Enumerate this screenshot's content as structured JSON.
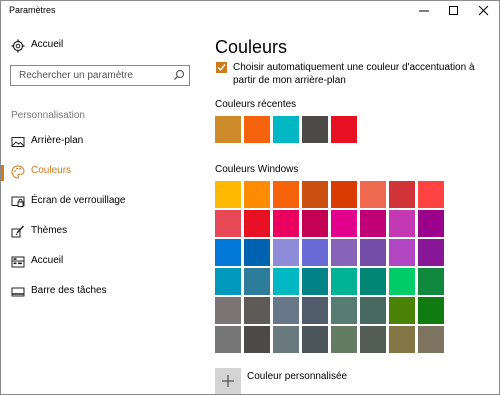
{
  "window": {
    "title": "Paramètres"
  },
  "sidebar": {
    "home_label": "Accueil",
    "search_placeholder": "Rechercher un paramètre",
    "section": "Personnalisation",
    "items": [
      {
        "label": "Arrière-plan",
        "icon": "image-icon"
      },
      {
        "label": "Couleurs",
        "icon": "palette-icon",
        "active": true
      },
      {
        "label": "Écran de verrouillage",
        "icon": "lock-screen-icon"
      },
      {
        "label": "Thèmes",
        "icon": "themes-icon"
      },
      {
        "label": "Accueil",
        "icon": "start-icon"
      },
      {
        "label": "Barre des tâches",
        "icon": "taskbar-icon"
      }
    ]
  },
  "main": {
    "title": "Couleurs",
    "auto_accent": {
      "checked": true,
      "label": "Choisir automatiquement une couleur d'accentuation à partir de mon arrière-plan"
    },
    "recent_title": "Couleurs récentes",
    "recent_colors": [
      "#cf8a2c",
      "#f7630c",
      "#00b7c3",
      "#4c4a48",
      "#e81123"
    ],
    "windows_title": "Couleurs Windows",
    "windows_colors": [
      [
        "#ffb900",
        "#ff8c00",
        "#f7630c",
        "#ca5010",
        "#da3b01",
        "#ef6950",
        "#d13438",
        "#ff4343"
      ],
      [
        "#e74856",
        "#e81123",
        "#ea005e",
        "#c30052",
        "#e3008c",
        "#bf0077",
        "#c239b3",
        "#9a0089"
      ],
      [
        "#0078d7",
        "#0063b1",
        "#8e8cd8",
        "#6b69d6",
        "#8764b8",
        "#744da9",
        "#b146c2",
        "#881798"
      ],
      [
        "#0099bc",
        "#2d7d9a",
        "#00b7c3",
        "#038387",
        "#00b294",
        "#018574",
        "#00cc6a",
        "#10893e"
      ],
      [
        "#7a7574",
        "#5d5a58",
        "#68768a",
        "#515c6b",
        "#567c73",
        "#486860",
        "#498205",
        "#107c10"
      ],
      [
        "#767676",
        "#4c4a48",
        "#69797e",
        "#4a5459",
        "#647c64",
        "#525e54",
        "#847545",
        "#7e735f"
      ]
    ],
    "custom_label": "Couleur personnalisée"
  },
  "accent_color": "#cf7b1a"
}
